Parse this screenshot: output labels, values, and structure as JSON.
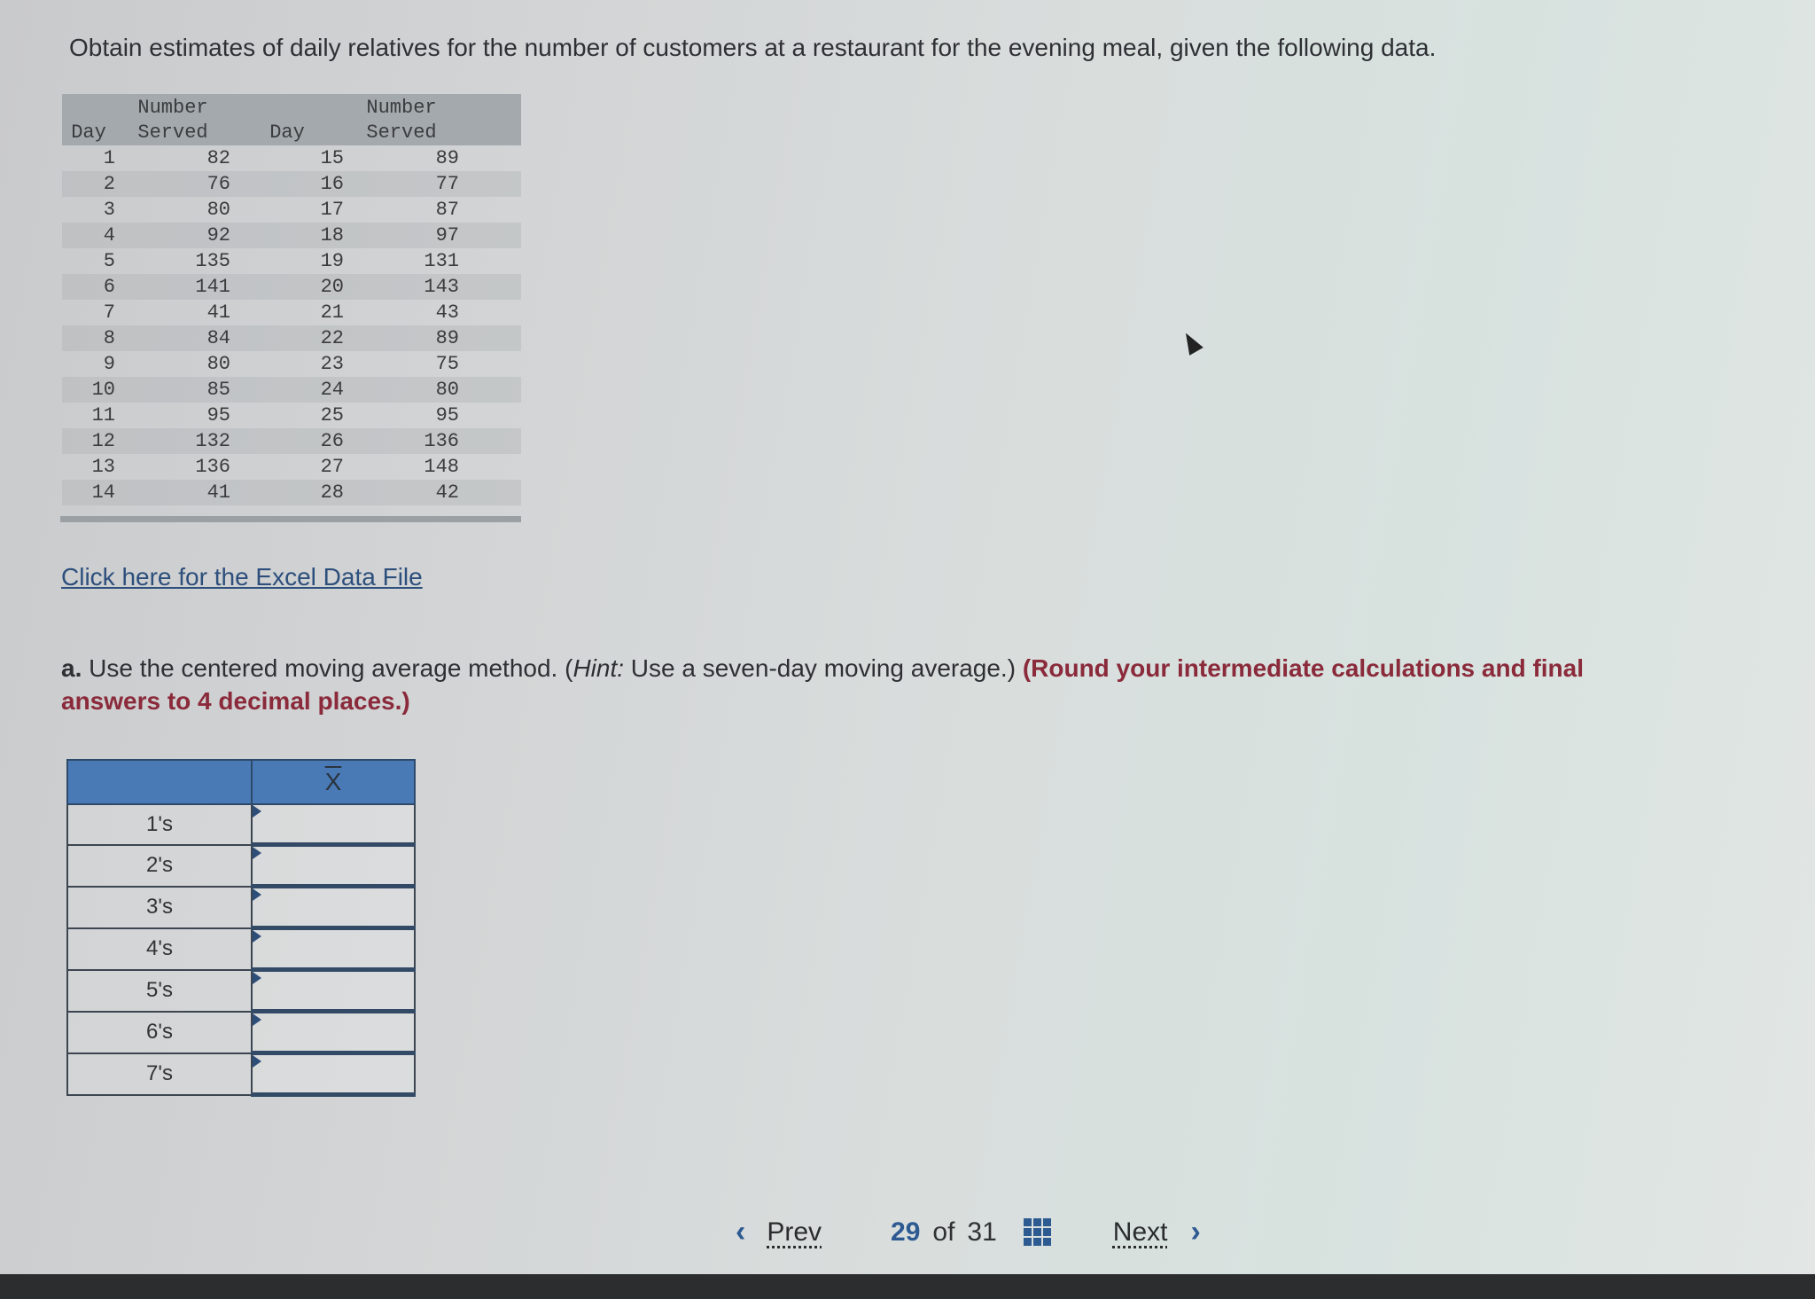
{
  "question": "Obtain estimates of daily relatives for the number of customers at a restaurant for the evening meal, given the following data.",
  "data_table": {
    "headers": {
      "day1": "Day",
      "num1_top": "Number",
      "num1_bottom": "Served",
      "day2": "Day",
      "num2_top": "Number",
      "num2_bottom": "Served"
    },
    "rows": [
      {
        "day1": "1",
        "num1": "82",
        "day2": "15",
        "num2": "89"
      },
      {
        "day1": "2",
        "num1": "76",
        "day2": "16",
        "num2": "77"
      },
      {
        "day1": "3",
        "num1": "80",
        "day2": "17",
        "num2": "87"
      },
      {
        "day1": "4",
        "num1": "92",
        "day2": "18",
        "num2": "97"
      },
      {
        "day1": "5",
        "num1": "135",
        "day2": "19",
        "num2": "131"
      },
      {
        "day1": "6",
        "num1": "141",
        "day2": "20",
        "num2": "143"
      },
      {
        "day1": "7",
        "num1": "41",
        "day2": "21",
        "num2": "43"
      },
      {
        "day1": "8",
        "num1": "84",
        "day2": "22",
        "num2": "89"
      },
      {
        "day1": "9",
        "num1": "80",
        "day2": "23",
        "num2": "75"
      },
      {
        "day1": "10",
        "num1": "85",
        "day2": "24",
        "num2": "80"
      },
      {
        "day1": "11",
        "num1": "95",
        "day2": "25",
        "num2": "95"
      },
      {
        "day1": "12",
        "num1": "132",
        "day2": "26",
        "num2": "136"
      },
      {
        "day1": "13",
        "num1": "136",
        "day2": "27",
        "num2": "148"
      },
      {
        "day1": "14",
        "num1": "41",
        "day2": "28",
        "num2": "42"
      }
    ]
  },
  "excel_link": "Click here for the Excel Data File",
  "part_a": {
    "label": "a.",
    "text": " Use the centered moving average method. (",
    "hint_label": "Hint:",
    "hint_text": " Use a seven-day moving average.) ",
    "emphasis": "(Round your intermediate calculations and final answers to 4 decimal places.)"
  },
  "answer_table": {
    "header_label": "",
    "header_value": "X",
    "rows": [
      {
        "label": "1's",
        "value": ""
      },
      {
        "label": "2's",
        "value": ""
      },
      {
        "label": "3's",
        "value": ""
      },
      {
        "label": "4's",
        "value": ""
      },
      {
        "label": "5's",
        "value": ""
      },
      {
        "label": "6's",
        "value": ""
      },
      {
        "label": "7's",
        "value": ""
      }
    ]
  },
  "nav": {
    "prev_label": "Prev",
    "current": "29",
    "of_label": "of",
    "total": "31",
    "next_label": "Next"
  },
  "colors": {
    "accent": "#2e5a92",
    "table_header": "#4a7ab5",
    "emphasis_red": "#8a2a3a",
    "link": "#2d4f7c"
  }
}
